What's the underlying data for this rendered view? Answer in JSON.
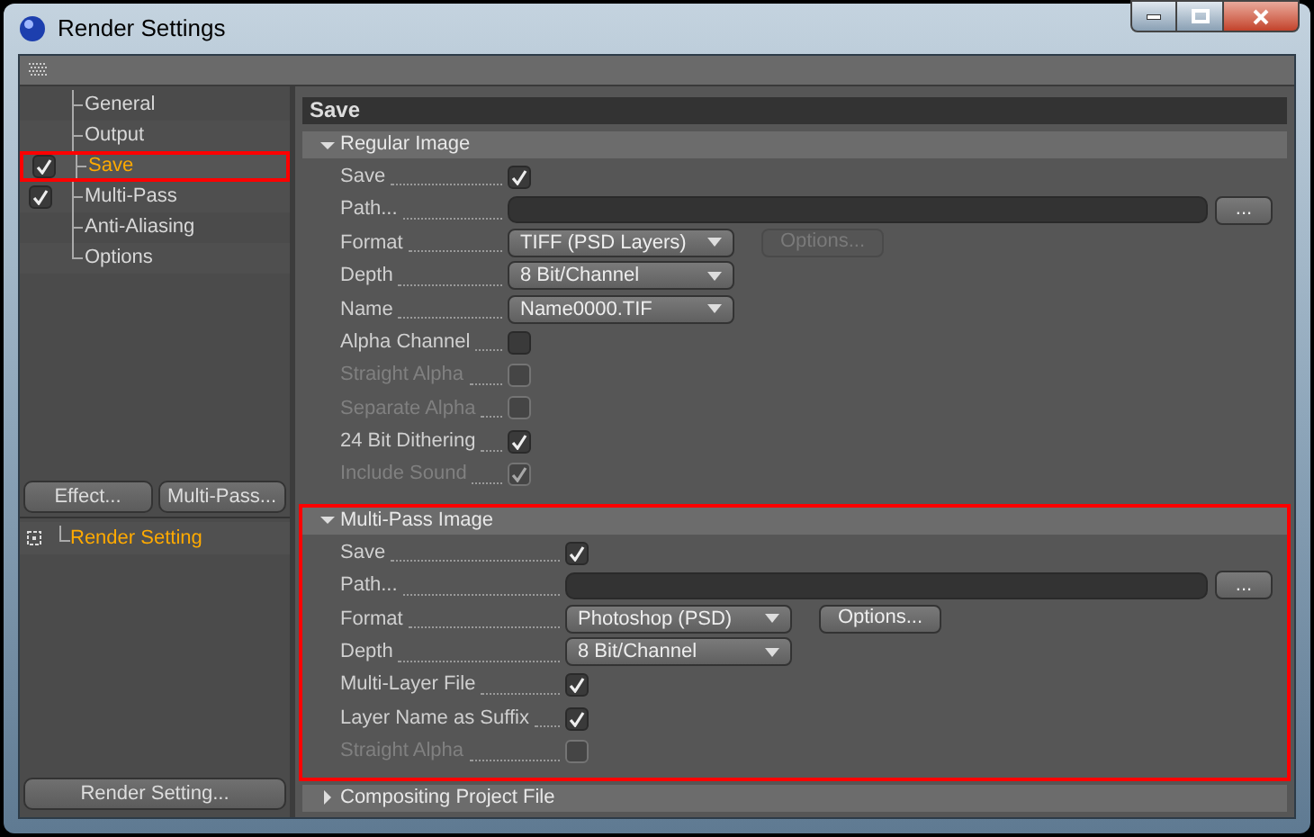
{
  "window": {
    "title": "Render Settings"
  },
  "sidebar": {
    "items": [
      {
        "label": "General",
        "checked": false,
        "selected": false,
        "highlighted": false
      },
      {
        "label": "Output",
        "checked": false,
        "selected": false,
        "highlighted": false
      },
      {
        "label": "Save",
        "checked": true,
        "selected": true,
        "highlighted": true
      },
      {
        "label": "Multi-Pass",
        "checked": true,
        "selected": false,
        "highlighted": false
      },
      {
        "label": "Anti-Aliasing",
        "checked": false,
        "selected": false,
        "highlighted": false
      },
      {
        "label": "Options",
        "checked": false,
        "selected": false,
        "highlighted": false
      }
    ],
    "buttons": [
      "Effect...",
      "Multi-Pass..."
    ],
    "settings_list": [
      {
        "label": "Render Setting",
        "selected": true
      }
    ],
    "bottom_button": "Render Setting..."
  },
  "panel": {
    "title": "Save",
    "sections": [
      {
        "title": "Regular Image",
        "expanded": true,
        "highlighted": false,
        "rows": [
          {
            "kind": "checkbox",
            "label": "Save",
            "checked": true,
            "disabled": false
          },
          {
            "kind": "path",
            "label": "Path...",
            "button": "..."
          },
          {
            "kind": "dropdown",
            "label": "Format",
            "value": "TIFF (PSD Layers)",
            "options_button": {
              "label": "Options...",
              "disabled": true
            }
          },
          {
            "kind": "dropdown",
            "label": "Depth",
            "value": "8 Bit/Channel"
          },
          {
            "kind": "dropdown",
            "label": "Name",
            "value": "Name0000.TIF"
          },
          {
            "kind": "checkbox",
            "label": "Alpha Channel",
            "checked": false,
            "disabled": false
          },
          {
            "kind": "checkbox",
            "label": "Straight Alpha",
            "checked": false,
            "disabled": true
          },
          {
            "kind": "checkbox",
            "label": "Separate Alpha",
            "checked": false,
            "disabled": true
          },
          {
            "kind": "checkbox",
            "label": "24 Bit Dithering",
            "checked": true,
            "disabled": false
          },
          {
            "kind": "checkbox",
            "label": "Include Sound",
            "checked": true,
            "disabled": true
          }
        ]
      },
      {
        "title": "Multi-Pass Image",
        "expanded": true,
        "highlighted": true,
        "rows": [
          {
            "kind": "checkbox",
            "label": "Save",
            "checked": true,
            "disabled": false
          },
          {
            "kind": "path",
            "label": "Path...",
            "button": "..."
          },
          {
            "kind": "dropdown",
            "label": "Format",
            "value": "Photoshop (PSD)",
            "options_button": {
              "label": "Options...",
              "disabled": false
            }
          },
          {
            "kind": "dropdown",
            "label": "Depth",
            "value": "8 Bit/Channel"
          },
          {
            "kind": "checkbox",
            "label": "Multi-Layer File",
            "checked": true,
            "disabled": false
          },
          {
            "kind": "checkbox",
            "label": "Layer Name as Suffix",
            "checked": true,
            "disabled": false
          },
          {
            "kind": "checkbox",
            "label": "Straight Alpha",
            "checked": false,
            "disabled": true
          }
        ]
      },
      {
        "title": "Compositing Project File",
        "expanded": false,
        "highlighted": false
      }
    ]
  }
}
